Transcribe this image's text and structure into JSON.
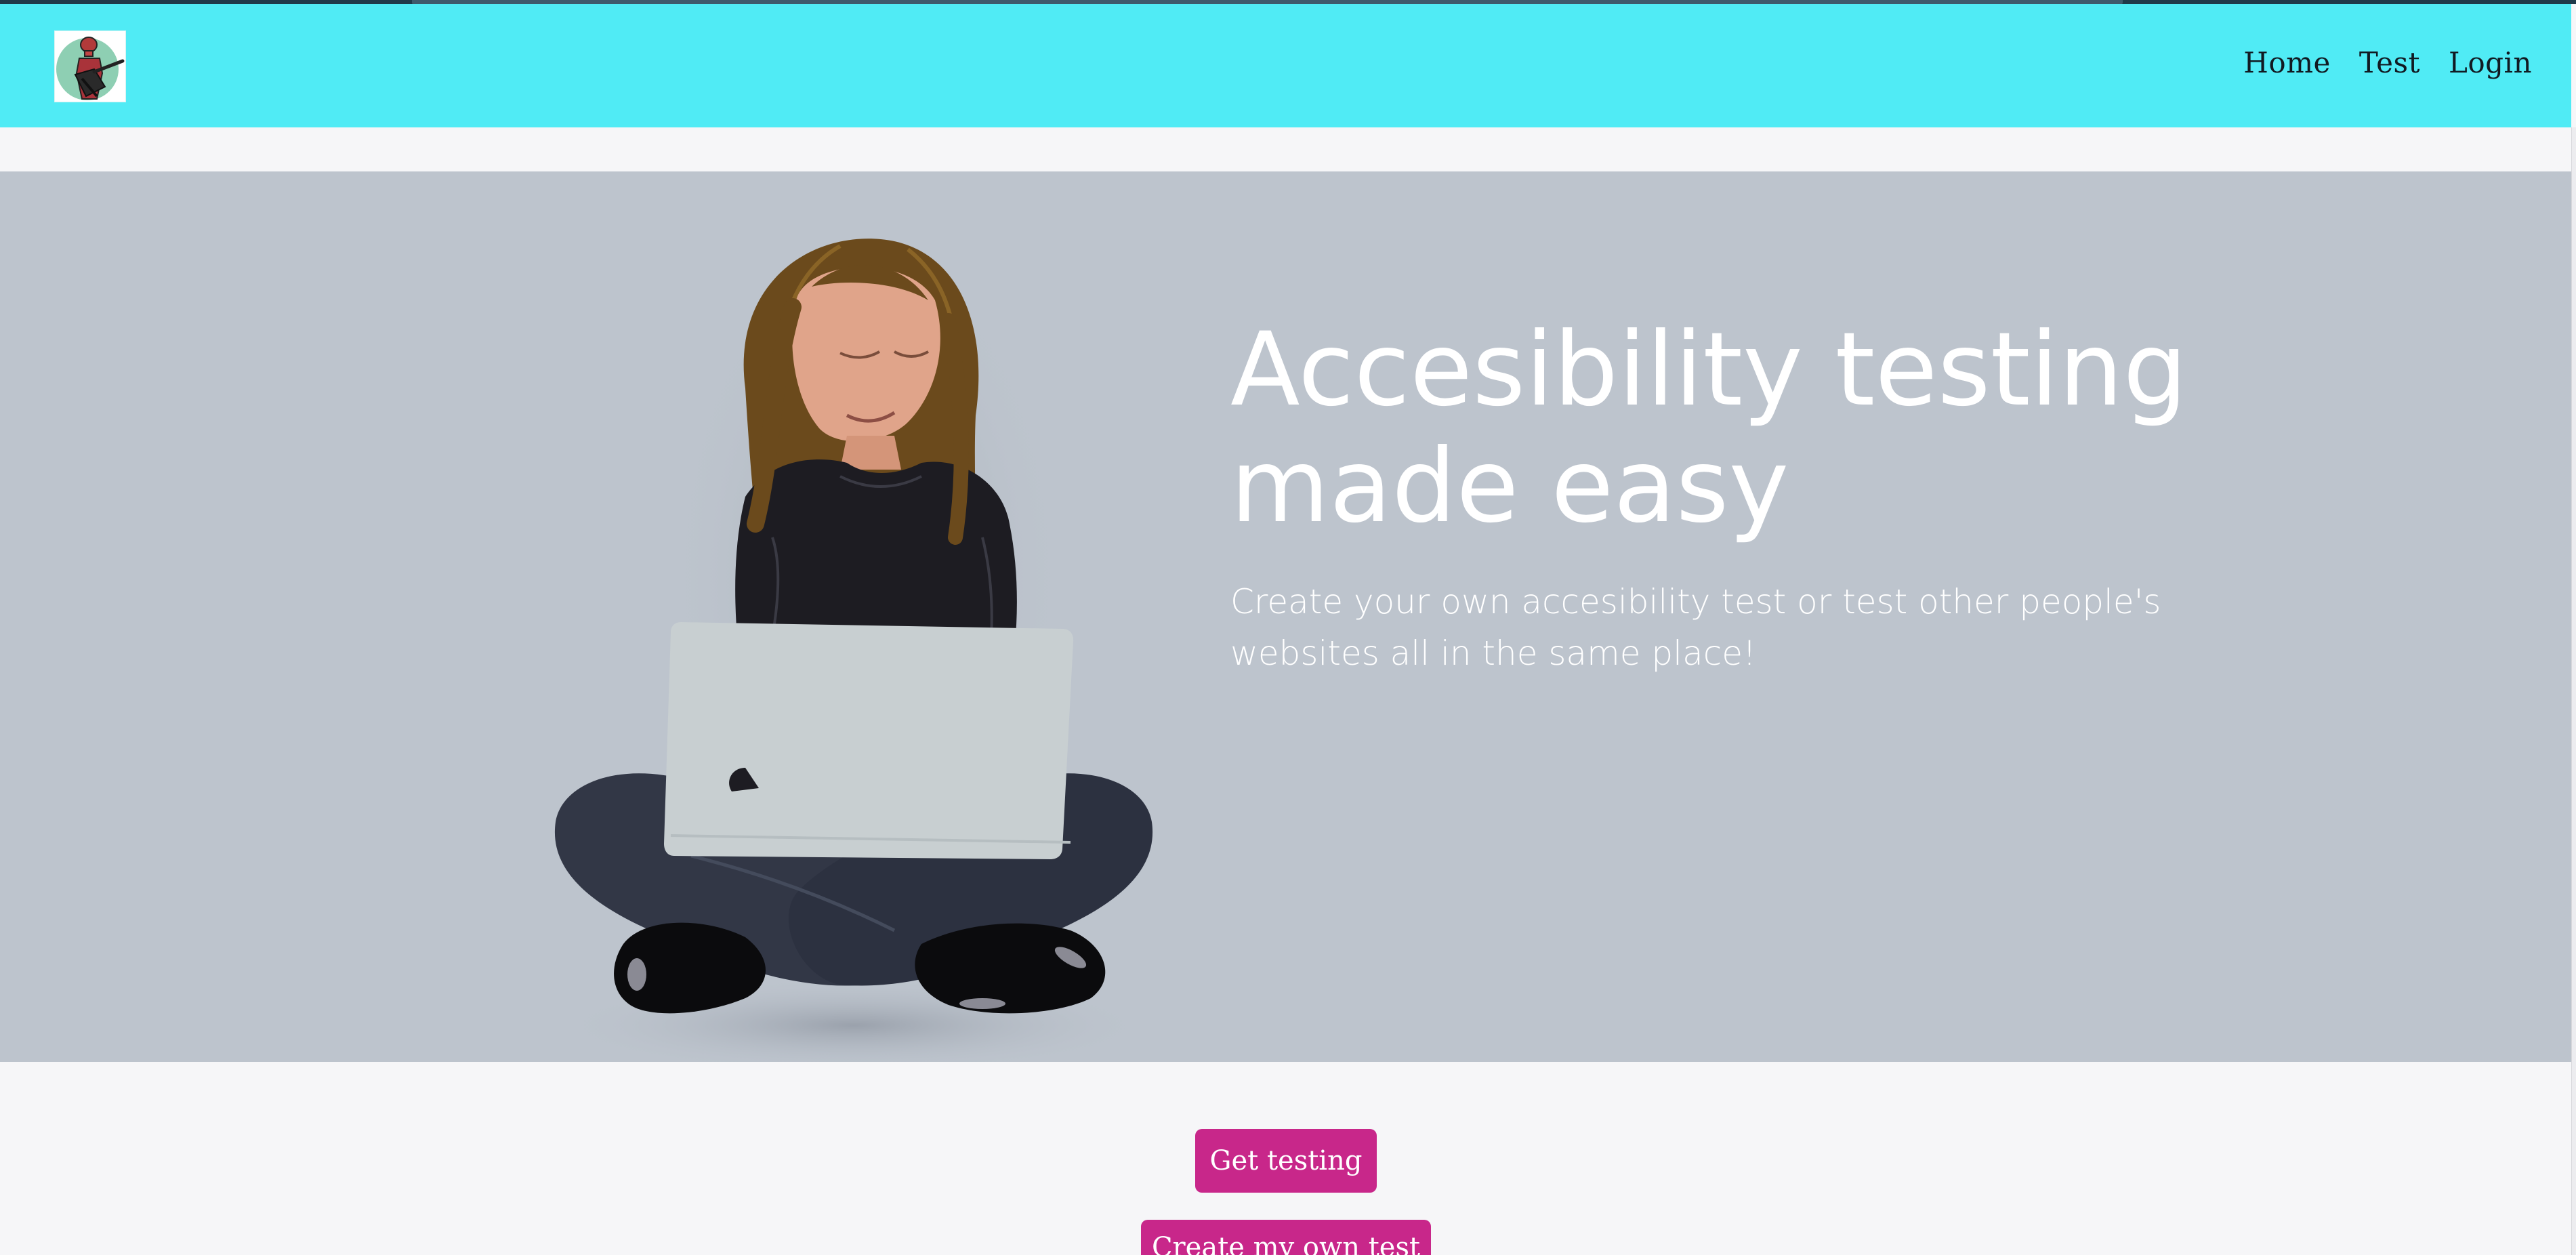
{
  "navbar": {
    "background": "#50ebf5",
    "logo_icon": "guitarist-logo-icon",
    "links": [
      "Home",
      "Test",
      "Login"
    ]
  },
  "hero": {
    "background": "#bdc4cd",
    "illustration_icon": "woman-with-laptop-illustration",
    "title": "Accesibility testing made easy",
    "subtitle": "Create your own accesibility test or test other people's websites all in the same place!"
  },
  "actions": {
    "accent": "#c8278a",
    "get_testing_label": "Get testing",
    "create_test_label": "Create my own test"
  }
}
